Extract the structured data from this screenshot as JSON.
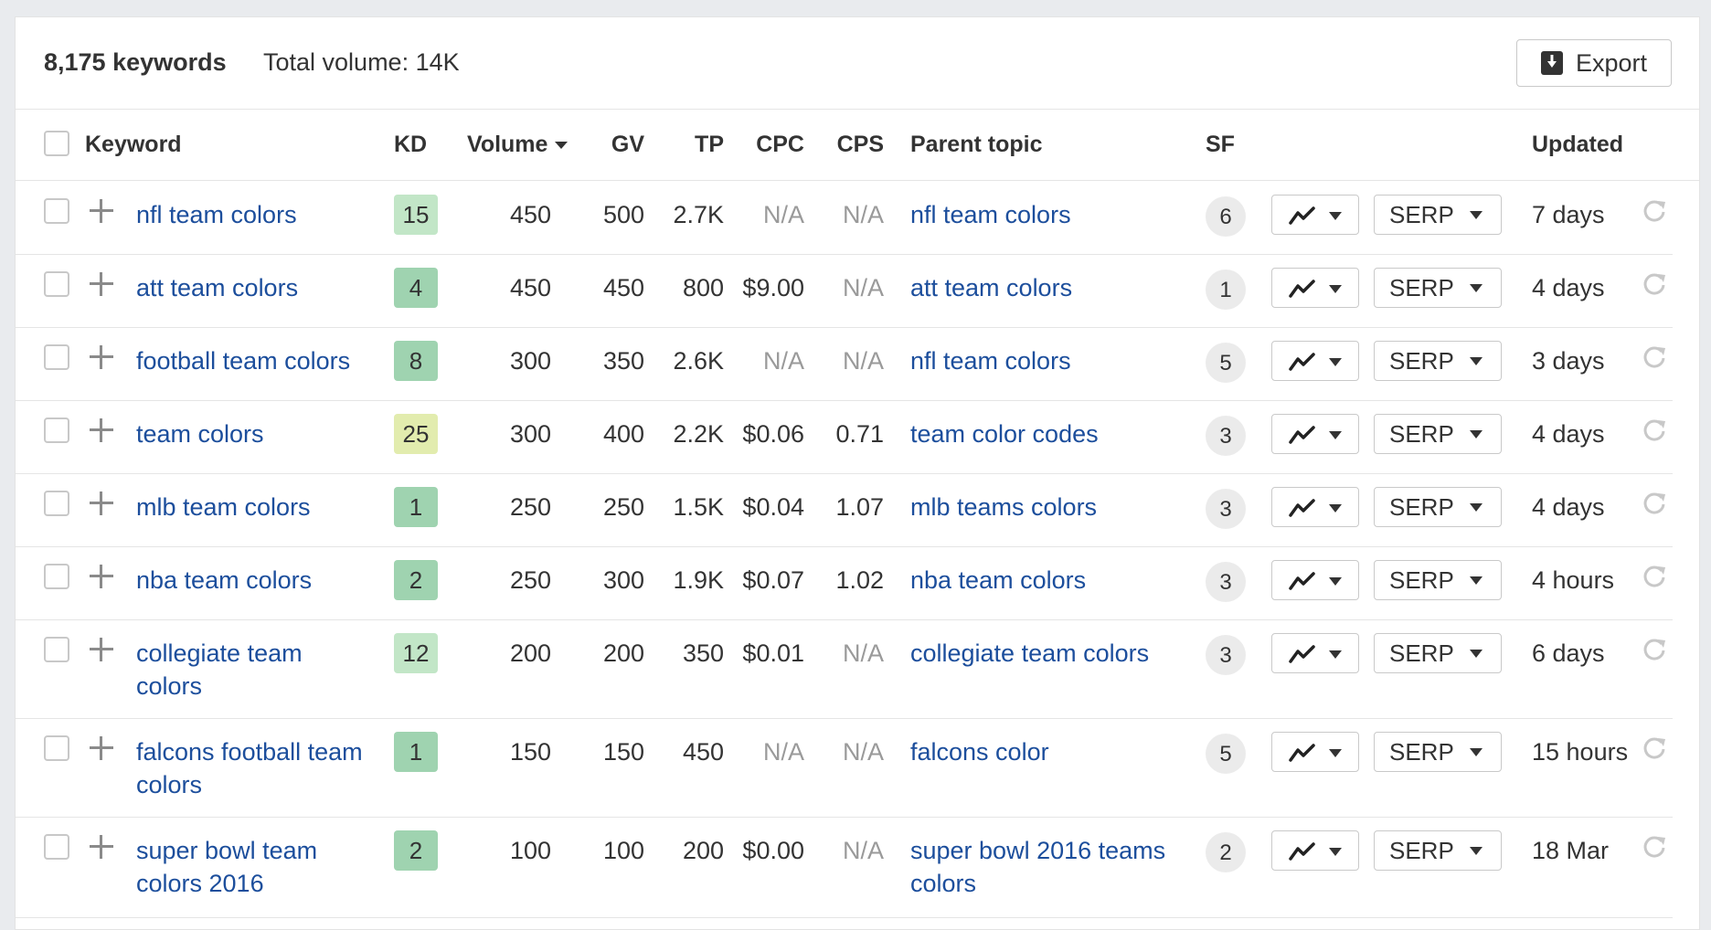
{
  "summary": {
    "keywords_count": "8,175 keywords",
    "total_volume": "Total volume: 14K",
    "export_label": "Export"
  },
  "columns": {
    "keyword": "Keyword",
    "kd": "KD",
    "volume": "Volume",
    "gv": "GV",
    "tp": "TP",
    "cpc": "CPC",
    "cps": "CPS",
    "parent_topic": "Parent topic",
    "sf": "SF",
    "updated": "Updated"
  },
  "serp_label": "SERP",
  "colors": {
    "link": "#1c4e9c",
    "kd_easy": "#9fd3b0",
    "kd_mid": "#c2e6c7",
    "kd_yellow": "#e2ecae"
  },
  "rows": [
    {
      "keyword": "nfl team colors",
      "kd": "15",
      "kd_color": "#c2e6c7",
      "volume": "450",
      "gv": "500",
      "tp": "2.7K",
      "cpc": "N/A",
      "cps": "N/A",
      "parent_topic": "nfl team colors",
      "sf": "6",
      "updated": "7 days"
    },
    {
      "keyword": "att team colors",
      "kd": "4",
      "kd_color": "#9fd3b0",
      "volume": "450",
      "gv": "450",
      "tp": "800",
      "cpc": "$9.00",
      "cps": "N/A",
      "parent_topic": "att team colors",
      "sf": "1",
      "updated": "4 days"
    },
    {
      "keyword": "football team colors",
      "kd": "8",
      "kd_color": "#9fd3b0",
      "volume": "300",
      "gv": "350",
      "tp": "2.6K",
      "cpc": "N/A",
      "cps": "N/A",
      "parent_topic": "nfl team colors",
      "sf": "5",
      "updated": "3 days"
    },
    {
      "keyword": "team colors",
      "kd": "25",
      "kd_color": "#e2ecae",
      "volume": "300",
      "gv": "400",
      "tp": "2.2K",
      "cpc": "$0.06",
      "cps": "0.71",
      "parent_topic": "team color codes",
      "sf": "3",
      "updated": "4 days"
    },
    {
      "keyword": "mlb team colors",
      "kd": "1",
      "kd_color": "#9fd3b0",
      "volume": "250",
      "gv": "250",
      "tp": "1.5K",
      "cpc": "$0.04",
      "cps": "1.07",
      "parent_topic": "mlb teams colors",
      "sf": "3",
      "updated": "4 days"
    },
    {
      "keyword": "nba team colors",
      "kd": "2",
      "kd_color": "#9fd3b0",
      "volume": "250",
      "gv": "300",
      "tp": "1.9K",
      "cpc": "$0.07",
      "cps": "1.02",
      "parent_topic": "nba team colors",
      "sf": "3",
      "updated": "4 hours"
    },
    {
      "keyword": "collegiate team colors",
      "kd": "12",
      "kd_color": "#c2e6c7",
      "volume": "200",
      "gv": "200",
      "tp": "350",
      "cpc": "$0.01",
      "cps": "N/A",
      "parent_topic": "collegiate team colors",
      "sf": "3",
      "updated": "6 days"
    },
    {
      "keyword": "falcons football team colors",
      "kd": "1",
      "kd_color": "#9fd3b0",
      "volume": "150",
      "gv": "150",
      "tp": "450",
      "cpc": "N/A",
      "cps": "N/A",
      "parent_topic": "falcons color",
      "sf": "5",
      "updated": "15 hours"
    },
    {
      "keyword": "super bowl team colors 2016",
      "kd": "2",
      "kd_color": "#9fd3b0",
      "volume": "100",
      "gv": "100",
      "tp": "200",
      "cpc": "$0.00",
      "cps": "N/A",
      "parent_topic": "super bowl 2016 teams colors",
      "sf": "2",
      "updated": "18 Mar"
    }
  ]
}
